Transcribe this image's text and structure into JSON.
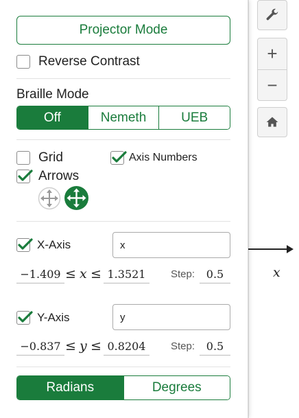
{
  "panel": {
    "projector_mode": "Projector Mode",
    "reverse_contrast": {
      "label": "Reverse Contrast",
      "checked": false
    },
    "braille": {
      "title": "Braille Mode",
      "options": [
        "Off",
        "Nemeth",
        "UEB"
      ],
      "selected": "Off"
    },
    "grid": {
      "label": "Grid",
      "checked": false
    },
    "axis_numbers": {
      "label": "Axis Numbers",
      "checked": true
    },
    "arrows": {
      "label": "Arrows",
      "checked": true
    },
    "x_axis": {
      "label": "X-Axis",
      "checked": true,
      "axis_label_value": "x",
      "min": "−1.409",
      "var": "x",
      "leq": "≤",
      "max": "1.3521",
      "step_label": "Step:",
      "step": "0.5"
    },
    "y_axis": {
      "label": "Y-Axis",
      "checked": true,
      "axis_label_value": "y",
      "min": "−0.837",
      "var": "y",
      "leq": "≤",
      "max": "0.8204",
      "step_label": "Step:",
      "step": "0.5"
    },
    "angle_mode": {
      "options": [
        "Radians",
        "Degrees"
      ],
      "selected": "Radians"
    }
  },
  "tools": {
    "settings_icon": "wrench-icon",
    "zoom_in": "+",
    "zoom_out": "−",
    "home_icon": "home-icon"
  },
  "graph": {
    "x_axis_label": "x"
  },
  "colors": {
    "accent": "#1a7c3c",
    "border": "#cfcfcf"
  }
}
